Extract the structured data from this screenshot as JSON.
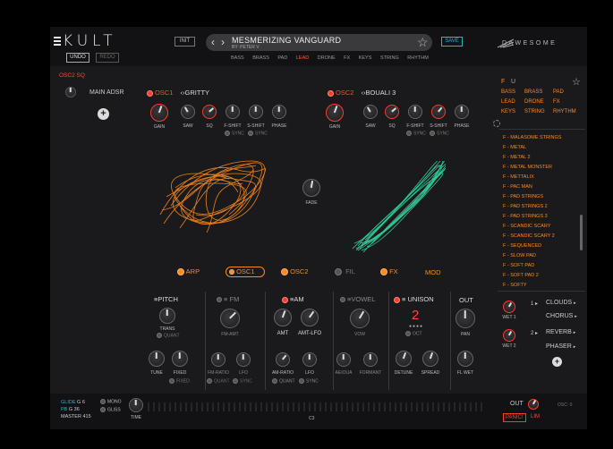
{
  "header": {
    "logo": "KULT",
    "undo": "UNDO",
    "redo": "REDO",
    "init": "INIT",
    "preset_name": "MESMERIZING VANGUARD",
    "preset_author": "BY: PETER V",
    "save": "SAVE",
    "brand": "DAWESOME",
    "categories": [
      "BASS",
      "BRASS",
      "PAD",
      "LEAD",
      "DRONE",
      "FX",
      "KEYS",
      "STRING",
      "RHYTHM"
    ],
    "active_category": "LEAD"
  },
  "left": {
    "osc_label": "OSC2 SQ",
    "main_adsr": "MAIN ADSR"
  },
  "osc1": {
    "label": "OSC1",
    "shape": "GRITTY",
    "knobs": [
      "GAIN",
      "SAW",
      "SQ",
      "F-SHIFT",
      "S-SHIFT",
      "PHASE"
    ],
    "sync1": "SYNC",
    "sync2": "SYNC"
  },
  "osc2": {
    "label": "OSC2",
    "shape": "BOUALI 3",
    "knobs": [
      "GAIN",
      "SAW",
      "SQ",
      "F-SHIFT",
      "S-SHIFT",
      "PHASE"
    ],
    "sync1": "SYNC",
    "sync2": "SYNC"
  },
  "center": {
    "fade": "FADE"
  },
  "tabs": [
    "ARP",
    "OSC1",
    "OSC2",
    "FIL",
    "FX",
    "MOD"
  ],
  "pitch": {
    "title": "PITCH",
    "trans": "TRANS",
    "quant": "QUANT",
    "tune": "TUNE",
    "fixed": "FIXED",
    "fixed_toggle": "FIXED"
  },
  "fm": {
    "title": "FM",
    "amt": "FM-AMT",
    "ratio": "FM-RATIO",
    "lfo": "LFO",
    "quant": "QUANT",
    "sync": "SYNC"
  },
  "am": {
    "title": "AM",
    "amt": "AMT",
    "amt_lfo": "AMT-LFO",
    "ratio": "AM-RATIO",
    "lfo": "LFO",
    "quant": "QUANT",
    "sync": "SYNC"
  },
  "vowel": {
    "title": "VOWEL",
    "vow": "VOW",
    "aeiou": "AEIOUA",
    "formant": "FORMANT"
  },
  "unison": {
    "title": "UNISON",
    "value": "2",
    "oct": "OCT",
    "detune": "DETUNE",
    "spread": "SPREAD"
  },
  "out": {
    "title": "OUT",
    "pan": "PAN",
    "flwet": "FL WET"
  },
  "browser": {
    "fav": "F",
    "user": "U",
    "grid": [
      "BASS",
      "BRASS",
      "PAD",
      "LEAD",
      "DRONE",
      "FX",
      "KEYS",
      "STRING",
      "RHYTHM"
    ],
    "presets": [
      "F - MALASOME STRINGS",
      "F - METAL",
      "F - METAL 2",
      "F - METAL MONSTER",
      "F - METTALIX",
      "F - PAC MAN",
      "F - PAD STRINGS",
      "F - PAD STRINGS 2",
      "F - PAD STRINGS 3",
      "F - SCANDIC SCARY",
      "F - SCANDIC SCARY 2",
      "F - SEQUENCED",
      "F - SLOW PAD",
      "F - SOFT PAD",
      "F - SOFT PAD 2",
      "F - SOFTY"
    ]
  },
  "fx": {
    "wet1": "WET 1",
    "wet2": "WET 2",
    "slot1": "1",
    "slot2": "2",
    "items": [
      "CLOUDS",
      "CHORUS",
      "REVERB",
      "PHASER"
    ]
  },
  "bottom": {
    "glide": "GLIDE",
    "glide_val": "G 6",
    "pb": "PB",
    "pb_val": "G 36",
    "master": "MASTER",
    "master_val": "415",
    "mono": "MONO",
    "gliss": "GLISS",
    "time": "TIME",
    "c3": "C3",
    "out": "OUT",
    "panic": "PANIC!",
    "lim": "LIM",
    "osc": "OSC:",
    "osc_val": "0"
  },
  "colors": {
    "accent_red": "#ff3a2a",
    "accent_orange": "#ff8a1e",
    "teal": "#2ab7c0",
    "scope_green": "#2fd3a0"
  }
}
